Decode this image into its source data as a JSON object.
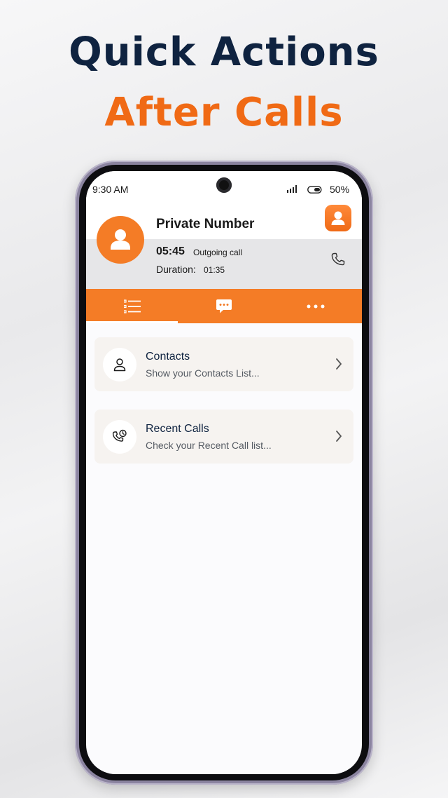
{
  "headline": {
    "line1": "Quick Actions",
    "line2": "After Calls"
  },
  "status_bar": {
    "time": "9:30 AM",
    "battery": "50%"
  },
  "caller": {
    "name": "Private Number",
    "call_time": "05:45",
    "call_type": "Outgoing call",
    "duration_label": "Duration:",
    "duration_value": "01:35"
  },
  "tabs": [
    {
      "icon": "list-icon",
      "selected": true
    },
    {
      "icon": "message-icon",
      "selected": false
    },
    {
      "icon": "more-icon",
      "selected": false
    }
  ],
  "actions": [
    {
      "title": "Contacts",
      "subtitle": "Show your Contacts List...",
      "icon": "person-icon"
    },
    {
      "title": "Recent Calls",
      "subtitle": "Check your Recent Call list...",
      "icon": "call-history-icon"
    }
  ],
  "colors": {
    "accent": "#f47c26",
    "headline_dark": "#0f2340",
    "headline_orange": "#f06a15"
  }
}
